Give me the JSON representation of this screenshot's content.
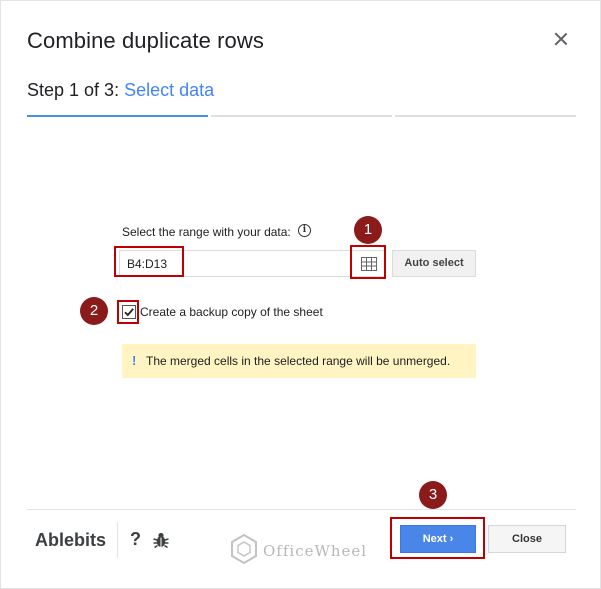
{
  "dialog": {
    "title": "Combine duplicate rows",
    "step_prefix": "Step 1 of 3:",
    "step_name": "Select data"
  },
  "range": {
    "label": "Select the range with your data:",
    "value": "B4:D13",
    "auto_select_label": "Auto select"
  },
  "backup": {
    "label": "Create a backup copy of the sheet",
    "checked": true
  },
  "notice": {
    "mark": "!",
    "message": "The merged cells in the selected range will be unmerged."
  },
  "footer": {
    "brand": "Ablebits",
    "help": "?",
    "next_label": "Next",
    "next_chevron": "›",
    "close_label": "Close"
  },
  "watermark": {
    "text": "OfficeWheel"
  },
  "annotations": [
    "1",
    "2",
    "3"
  ],
  "colors": {
    "accent": "#4285f4",
    "highlight": "#c00000",
    "badge": "#8b1a1a",
    "notice_bg": "#fff4c2"
  },
  "icons": [
    "close-icon",
    "info-icon",
    "grid-icon",
    "checkmark-icon",
    "bug-icon"
  ]
}
